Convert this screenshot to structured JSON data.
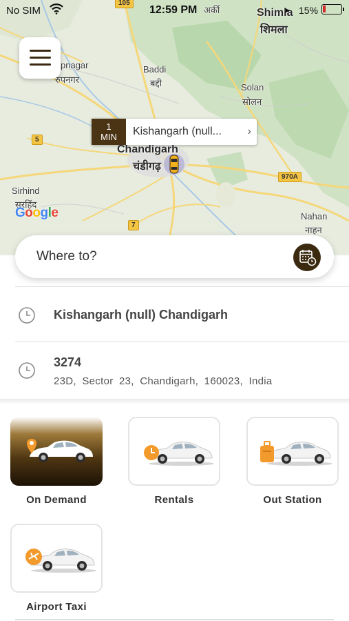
{
  "status_bar": {
    "carrier": "No SIM",
    "time": "12:59 PM",
    "battery_percent": "15%",
    "icons": [
      "wifi-icon",
      "location-arrow-icon",
      "battery-low-icon"
    ],
    "battery_level": 0.15,
    "battery_color": "#d62828"
  },
  "map": {
    "eta_minutes": "1",
    "eta_unit": "MIN",
    "eta_place": "Kishangarh (null...",
    "places": [
      {
        "name": "अर्की"
      },
      {
        "name": "Shimla"
      },
      {
        "name": "शिमला"
      },
      {
        "name": "pnagar"
      },
      {
        "name": "रुपनगर"
      },
      {
        "name": "Baddi"
      },
      {
        "name": "बद्दी"
      },
      {
        "name": "Solan"
      },
      {
        "name": "सोलन"
      },
      {
        "name": "Chandigarh"
      },
      {
        "name": "चंडीगढ़"
      },
      {
        "name": "Sirhind"
      },
      {
        "name": "सरहिंद"
      },
      {
        "name": "Nahan"
      },
      {
        "name": "नाहन"
      }
    ],
    "road_shields": [
      "105",
      "5",
      "970A",
      "7"
    ],
    "attribution": "Google"
  },
  "search": {
    "placeholder": "Where to?",
    "schedule_icon": "calendar-clock-icon"
  },
  "recent_places": [
    {
      "title": "Kishangarh (null) Chandigarh",
      "subtitle": ""
    },
    {
      "title": "3274",
      "subtitle": "23D, Sector 23, Chandigarh, 160023, India"
    }
  ],
  "services": [
    {
      "label": "On Demand",
      "icon": "location-pin-icon",
      "selected": true
    },
    {
      "label": "Rentals",
      "icon": "clock-icon",
      "selected": false
    },
    {
      "label": "Out Station",
      "icon": "luggage-icon",
      "selected": false
    },
    {
      "label": "Airport Taxi",
      "icon": "airplane-icon",
      "selected": false
    }
  ],
  "colors": {
    "brand_dark": "#3b2a10",
    "accent_orange": "#f39a2d"
  }
}
